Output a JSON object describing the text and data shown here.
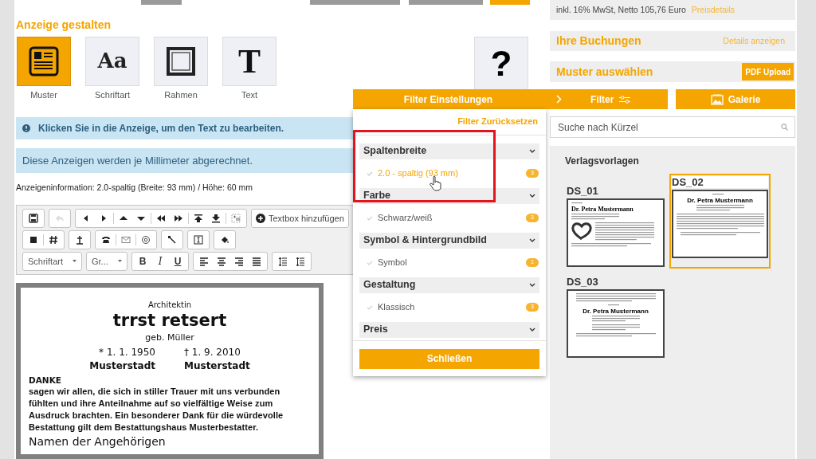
{
  "section_title": "Anzeige gestalten",
  "design_tools": [
    {
      "label": "Muster",
      "kind": "pattern",
      "selected": true
    },
    {
      "label": "Schriftart",
      "kind": "font",
      "glyph": "Aa",
      "selected": false
    },
    {
      "label": "Rahmen",
      "kind": "frame",
      "selected": false
    },
    {
      "label": "Text",
      "kind": "text",
      "glyph": "T",
      "selected": false
    }
  ],
  "help_button": {
    "symbol": "?"
  },
  "info_alert": "Klicken Sie in die Anzeige, um den Text zu bearbeiten.",
  "notice": "Diese Anzeigen werden je Millimeter abgerechnet.",
  "ad_info": "Anzeigeninformation: 2.0-spaltig (Breite: 93 mm) / Höhe: 60 mm",
  "editor_toolbar": {
    "undo": {
      "disabled": true
    },
    "add_textbox": "Textbox hinzufügen",
    "font_dropdown": "Schriftart",
    "size_dropdown": "Gr...",
    "bold": "B",
    "italic": "I",
    "underline": "U"
  },
  "ad_preview": {
    "occupation": "Architektin",
    "name": "trrst retsert",
    "maiden_name": "geb. Müller",
    "birth": "* 1. 1. 1950",
    "death": "† 1. 9. 2010",
    "birth_place": "Musterstadt",
    "death_place": "Musterstadt",
    "heading": "DANKE",
    "body": "sagen wir allen, die sich in stiller Trauer mit uns verbunden fühlten und ihre Anteilnahme auf so vielfältige Weise zum Ausdruck brachten. Ein besonderer Dank für die würdevolle Bestattung gilt dem Bestattungshaus Musterbestatter.",
    "signature": "Namen der Angehörigen"
  },
  "price": {
    "text": "inkl. 16% MwSt, Netto 105,76 Euro",
    "link": "Preisdetails"
  },
  "bookings": {
    "title": "Ihre Buchungen",
    "link": "Details anzeigen"
  },
  "pattern": {
    "title": "Muster auswählen",
    "button": "PDF Upload"
  },
  "filter_button": "Filter",
  "gallery_button": "Galerie",
  "search": {
    "placeholder": "Suche nach Kürzel"
  },
  "templates": {
    "title": "Verlagsvorlagen",
    "items": [
      {
        "code": "DS_01",
        "kind": "heart",
        "selected": false,
        "name": "Dr. Petra Mustermann"
      },
      {
        "code": "DS_02",
        "kind": "classic",
        "selected": true,
        "name": "Dr. Petra Mustermann"
      },
      {
        "code": "DS_03",
        "kind": "intro",
        "selected": false,
        "name": "Dr. Petra Mustermann"
      }
    ]
  },
  "filter_panel": {
    "title": "Filter Einstellungen",
    "reset": "Filter Zurücksetzen",
    "groups": [
      {
        "title": "Spaltenbreite",
        "options": [
          {
            "label": "2.0 - spaltig (93 mm)",
            "count": "3",
            "selected": true
          }
        ]
      },
      {
        "title": "Farbe",
        "options": [
          {
            "label": "Schwarz/weiß",
            "count": "3",
            "selected": false
          }
        ]
      },
      {
        "title": "Symbol & Hintergrundbild",
        "options": [
          {
            "label": "Symbol",
            "count": "1",
            "selected": false
          }
        ]
      },
      {
        "title": "Gestaltung",
        "options": [
          {
            "label": "Klassisch",
            "count": "3",
            "selected": false
          }
        ]
      },
      {
        "title": "Preis"
      }
    ],
    "close": "Schließen"
  }
}
